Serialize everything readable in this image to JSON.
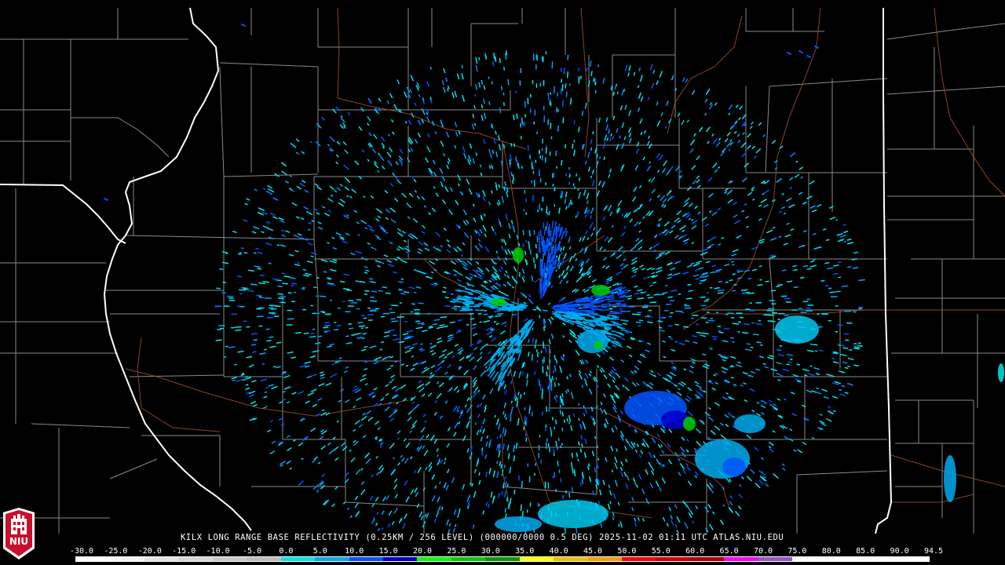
{
  "product": {
    "title": "KILX LONG RANGE BASE REFLECTIVITY (0.25KM / 256 LEVEL) (000000/0000 0.5 DEG) 2025-11-02 01:11 UTC  ATLAS.NIU.EDU"
  },
  "logo": {
    "text": "NIU",
    "color": "#c8102e"
  },
  "scale": {
    "labels": [
      "-30.0",
      "-25.0",
      "-20.0",
      "-15.0",
      "-10.0",
      "-5.0",
      "0.0",
      "5.0",
      "10.0",
      "15.0",
      "20.0",
      "25.0",
      "30.0",
      "35.0",
      "40.0",
      "45.0",
      "50.0",
      "55.0",
      "60.0",
      "65.0",
      "70.0",
      "75.0",
      "80.0",
      "85.0",
      "90.0",
      "94.5"
    ],
    "colors": [
      "#ffffff",
      "#f2f2f2",
      "#e4e4e4",
      "#d6d6d6",
      "#c8c8c8",
      "#bcbcbc",
      "#00e6e6",
      "#00aaee",
      "#0055ff",
      "#0000cc",
      "#00ff00",
      "#00cc00",
      "#009900",
      "#ffff00",
      "#e6c000",
      "#ff9900",
      "#ff0000",
      "#d40000",
      "#b00000",
      "#ff00ff",
      "#9955cc",
      "#ffffff",
      "#ffffff",
      "#ffffff",
      "#ffffff"
    ]
  },
  "map": {
    "state_border_color": "#ffffff",
    "county_line_color": "#8a8a8a",
    "road_color": "#a0522d"
  }
}
